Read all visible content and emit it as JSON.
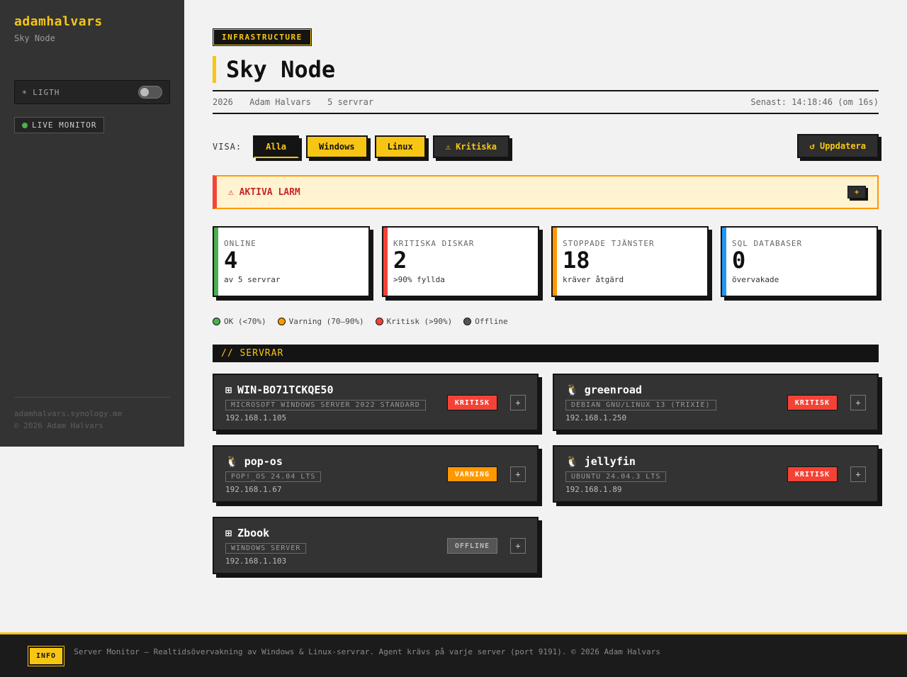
{
  "sidebar": {
    "brand": "adamhalvars",
    "subtitle": "Sky Node",
    "theme_icon": "sun-icon",
    "theme_label": "LIGTH",
    "live_label": "LIVE MONITOR",
    "footer_host": "adamhalvars.synology.me",
    "footer_copy": "© 2026 Adam Halvars"
  },
  "header": {
    "tag": "INFRASTRUCTURE",
    "title": "Sky Node",
    "year": "2026",
    "owner": "Adam Halvars",
    "servers_count": "5 servrar",
    "last_update": "Senast: 14:18:46 (om 16s)"
  },
  "filters": {
    "label": "VISA:",
    "items": [
      "Alla",
      "Windows",
      "Linux",
      "⚠ Kritiska"
    ],
    "refresh": "↺ Uppdatera"
  },
  "alarm": {
    "title": "⚠ AKTIVA LARM",
    "toggle": "+"
  },
  "stats": [
    {
      "label": "ONLINE",
      "value": "4",
      "sub": "av 5 servrar",
      "color": "#4caf50"
    },
    {
      "label": "KRITISKA DISKAR",
      "value": "2",
      "sub": ">90% fyllda",
      "color": "#f44336"
    },
    {
      "label": "STOPPADE TJÄNSTER",
      "value": "18",
      "sub": "kräver åtgärd",
      "color": "#ff9800"
    },
    {
      "label": "SQL DATABASER",
      "value": "0",
      "sub": "övervakade",
      "color": "#2196f3"
    }
  ],
  "legend": [
    {
      "label": "OK (<70%)",
      "color": "#4caf50"
    },
    {
      "label": "Varning (70–90%)",
      "color": "#ff9800"
    },
    {
      "label": "Kritisk (>90%)",
      "color": "#f44336"
    },
    {
      "label": "Offline",
      "color": "#555555"
    }
  ],
  "section_title": "// SERVRAR",
  "servers": [
    {
      "icon": "⊞",
      "name": "WIN-BO71TCKQE50",
      "os": "MICROSOFT WINDOWS SERVER 2022 STANDARD",
      "ip": "192.168.1.105",
      "status": "KRITISK",
      "status_color": "#f44336"
    },
    {
      "icon": "🐧",
      "name": "greenroad",
      "os": "DEBIAN GNU/LINUX 13 (TRIXIE)",
      "ip": "192.168.1.250",
      "status": "KRITISK",
      "status_color": "#f44336"
    },
    {
      "icon": "🐧",
      "name": "pop-os",
      "os": "POP!_OS 24.04 LTS",
      "ip": "192.168.1.67",
      "status": "VARNING",
      "status_color": "#ff9800"
    },
    {
      "icon": "🐧",
      "name": "jellyfin",
      "os": "UBUNTU 24.04.3 LTS",
      "ip": "192.168.1.89",
      "status": "KRITISK",
      "status_color": "#f44336"
    },
    {
      "icon": "⊞",
      "name": "Zbook",
      "os": "WINDOWS SERVER",
      "ip": "192.168.1.103",
      "status": "OFFLINE",
      "status_color": "#555555"
    }
  ],
  "server_plus": "+",
  "footer": {
    "badge": "INFO",
    "text": "Server Monitor — Realtidsövervakning av Windows & Linux-servrar. Agent krävs på varje server (port 9191). © 2026 Adam Halvars"
  }
}
